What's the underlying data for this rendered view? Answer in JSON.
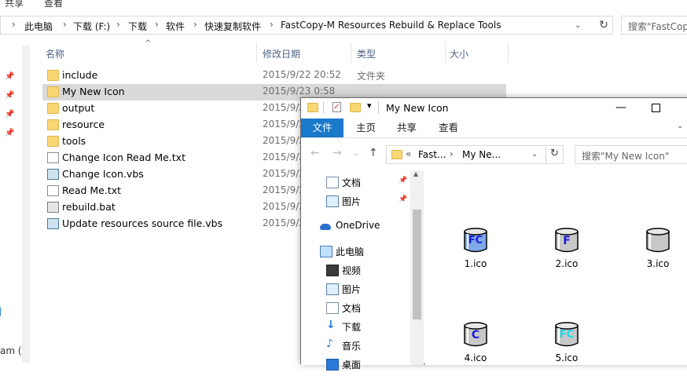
{
  "back_window": {
    "ribbon_tabs": [
      "共享",
      "查看"
    ],
    "breadcrumbs": [
      "此电脑",
      "下载 (F:)",
      "下载",
      "软件",
      "快速复制软件",
      "FastCopy-M Resources Rebuild & Replace Tools"
    ],
    "search_placeholder": "搜索\"FastCop",
    "columns": [
      "名称",
      "修改日期",
      "类型",
      "大小"
    ],
    "files": [
      {
        "name": "include",
        "date": "2015/9/22 20:52",
        "type": "文件夹",
        "kind": "folder"
      },
      {
        "name": "My New Icon",
        "date": "2015/9/23 0:58",
        "type": "",
        "kind": "folder",
        "selected": true
      },
      {
        "name": "output",
        "date": "2015/9/2",
        "type": "",
        "kind": "folder"
      },
      {
        "name": "resource",
        "date": "2015/9/2",
        "type": "",
        "kind": "folder"
      },
      {
        "name": "tools",
        "date": "2015/9/2",
        "type": "",
        "kind": "folder"
      },
      {
        "name": "Change Icon Read Me.txt",
        "date": "2015/9/2",
        "type": "",
        "kind": "txt"
      },
      {
        "name": "Change Icon.vbs",
        "date": "2015/9/2",
        "type": "",
        "kind": "vbs"
      },
      {
        "name": "Read Me.txt",
        "date": "2015/9/2",
        "type": "",
        "kind": "txt"
      },
      {
        "name": "rebuild.bat",
        "date": "2015/9/2",
        "type": "",
        "kind": "bat"
      },
      {
        "name": "Update resources source file.vbs",
        "date": "2015/9/2",
        "type": "",
        "kind": "vbs"
      }
    ],
    "left_partial_text": "am ("
  },
  "front_window": {
    "title": "My New Icon",
    "ribbon_tabs": {
      "file": "文件",
      "home": "主页",
      "share": "共享",
      "view": "查看"
    },
    "address_prefix": "«",
    "breadcrumbs": [
      "Fast...",
      "My Ne..."
    ],
    "search_placeholder": "搜索\"My New Icon\"",
    "nav_items": [
      {
        "label": "文档",
        "icon": "document-icon",
        "pinned": true
      },
      {
        "label": "图片",
        "icon": "pictures-icon",
        "pinned": true
      },
      {
        "label": "OneDrive",
        "icon": "onedrive-icon"
      },
      {
        "label": "此电脑",
        "icon": "computer-icon"
      },
      {
        "label": "视频",
        "icon": "video-icon"
      },
      {
        "label": "图片",
        "icon": "pictures-icon"
      },
      {
        "label": "文档",
        "icon": "document-icon"
      },
      {
        "label": "下载",
        "icon": "download-icon"
      },
      {
        "label": "音乐",
        "icon": "music-icon"
      },
      {
        "label": "桌面",
        "icon": "desktop-icon"
      }
    ],
    "icons": [
      {
        "name": "1.ico",
        "glyph": "FC",
        "glyph_color": "#1a1adc",
        "body": "#7fa8e8"
      },
      {
        "name": "2.ico",
        "glyph": "F",
        "glyph_color": "#1a1adc",
        "body": "#c8c8c8"
      },
      {
        "name": "3.ico",
        "glyph": "",
        "glyph_color": "#000000",
        "body": "#c8c8c8"
      },
      {
        "name": "4.ico",
        "glyph": "C",
        "glyph_color": "#1a1adc",
        "body": "#c8c8c8"
      },
      {
        "name": "5.ico",
        "glyph": "FC",
        "glyph_color": "#18d8e8",
        "body": "#c8c8c8"
      }
    ]
  },
  "colors": {
    "accent": "#1979ca",
    "folder": "#f8d775",
    "selection": "#d9d9d9"
  }
}
